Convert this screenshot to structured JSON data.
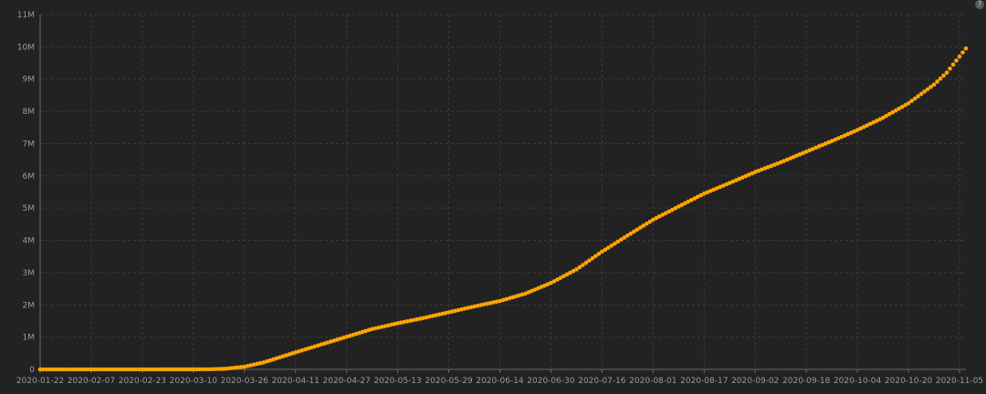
{
  "chart_data": {
    "type": "scatter",
    "title": "",
    "xlabel": "",
    "ylabel": "",
    "x_start": "2020-01-22",
    "x_end": "2020-11-07",
    "ylim": [
      0,
      11000000
    ],
    "grid": true,
    "marker_color": "#FFA500",
    "x_ticks": [
      "2020-01-22",
      "2020-02-07",
      "2020-02-23",
      "2020-03-10",
      "2020-03-26",
      "2020-04-11",
      "2020-04-27",
      "2020-05-13",
      "2020-05-29",
      "2020-06-14",
      "2020-06-30",
      "2020-07-16",
      "2020-08-01",
      "2020-08-17",
      "2020-09-02",
      "2020-09-18",
      "2020-10-04",
      "2020-10-20",
      "2020-11-05"
    ],
    "y_ticks": [
      0,
      1000000,
      2000000,
      3000000,
      4000000,
      5000000,
      6000000,
      7000000,
      8000000,
      9000000,
      10000000,
      11000000
    ],
    "y_tick_labels": [
      "0",
      "1M",
      "2M",
      "3M",
      "4M",
      "5M",
      "6M",
      "7M",
      "8M",
      "9M",
      "10M",
      "11M"
    ],
    "series": [
      {
        "x": [
          "2020-01-22",
          "2020-02-07",
          "2020-02-23",
          "2020-03-10",
          "2020-03-15",
          "2020-03-20",
          "2020-03-26",
          "2020-04-01",
          "2020-04-11",
          "2020-04-20",
          "2020-04-27",
          "2020-05-05",
          "2020-05-13",
          "2020-05-21",
          "2020-05-29",
          "2020-06-06",
          "2020-06-14",
          "2020-06-22",
          "2020-06-30",
          "2020-07-08",
          "2020-07-16",
          "2020-07-24",
          "2020-08-01",
          "2020-08-09",
          "2020-08-17",
          "2020-08-25",
          "2020-09-02",
          "2020-09-10",
          "2020-09-18",
          "2020-09-26",
          "2020-10-04",
          "2020-10-12",
          "2020-10-20",
          "2020-10-28",
          "2020-11-01",
          "2020-11-05",
          "2020-11-07"
        ],
        "y": [
          0,
          12,
          15,
          1000,
          3500,
          19000,
          83000,
          215000,
          527000,
          800000,
          1010000,
          1250000,
          1430000,
          1590000,
          1770000,
          1950000,
          2120000,
          2350000,
          2680000,
          3100000,
          3650000,
          4150000,
          4640000,
          5050000,
          5450000,
          5780000,
          6120000,
          6420000,
          6750000,
          7080000,
          7420000,
          7800000,
          8250000,
          8830000,
          9200000,
          9700000,
          9950000
        ]
      }
    ]
  },
  "corner_icon_glyph": "?"
}
